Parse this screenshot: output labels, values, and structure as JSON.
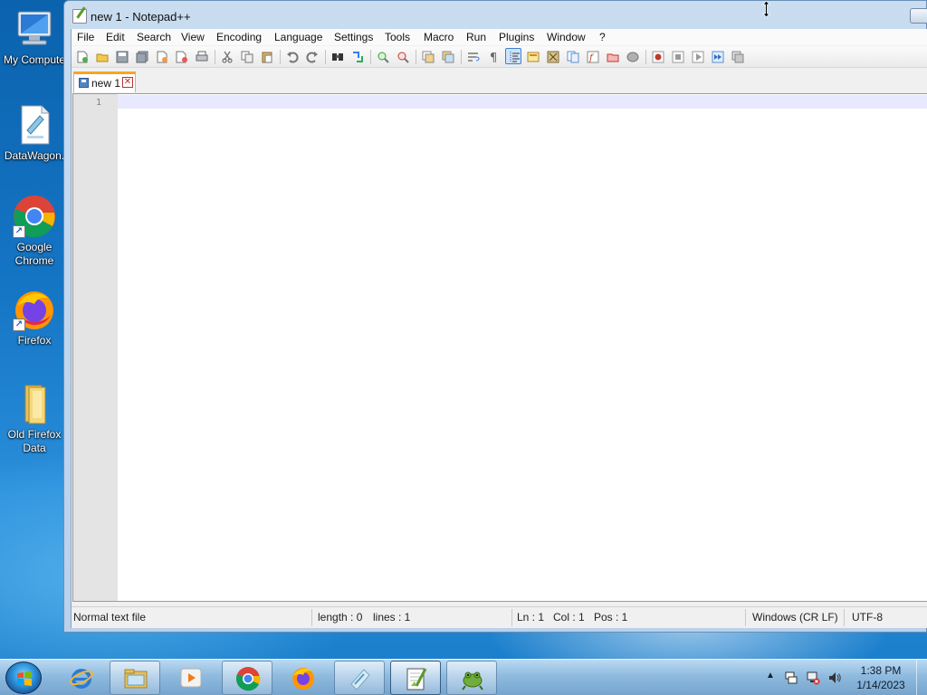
{
  "desktop": {
    "icons": [
      {
        "label": "My Compute",
        "icon": "computer-icon"
      },
      {
        "label": "DataWagon.",
        "icon": "document-icon"
      },
      {
        "label": "Google Chrome",
        "icon": "chrome-icon"
      },
      {
        "label": "Firefox",
        "icon": "firefox-icon"
      },
      {
        "label": "Old Firefox Data",
        "icon": "folder-icon"
      }
    ]
  },
  "window": {
    "title": "new 1 - Notepad++",
    "menu": [
      "File",
      "Edit",
      "Search",
      "View",
      "Encoding",
      "Language",
      "Settings",
      "Tools",
      "Macro",
      "Run",
      "Plugins",
      "Window",
      "?"
    ],
    "toolbar": [
      "new-file-icon",
      "open-file-icon",
      "save-icon",
      "save-all-icon",
      "close-icon",
      "close-all-icon",
      "print-icon",
      "cut-icon",
      "copy-icon",
      "paste-icon",
      "undo-icon",
      "redo-icon",
      "find-icon",
      "replace-icon",
      "zoom-in-icon",
      "zoom-out-icon",
      "sync-vertical-icon",
      "sync-horizontal-icon",
      "word-wrap-icon",
      "show-all-chars-icon",
      "indent-guide-icon",
      "user-defined-language-icon",
      "document-map-icon",
      "document-list-icon",
      "function-list-icon",
      "folder-as-workspace-icon",
      "monitoring-icon",
      "record-macro-icon",
      "stop-macro-icon",
      "play-macro-icon",
      "run-macro-multiple-icon",
      "save-macro-icon"
    ],
    "tab": {
      "label": "new 1"
    },
    "editor": {
      "line_number": "1"
    },
    "status": {
      "file_type": "Normal text file",
      "length": "length : 0",
      "lines": "lines : 1",
      "ln": "Ln : 1",
      "col": "Col : 1",
      "pos": "Pos : 1",
      "eol": "Windows (CR LF)",
      "encoding": "UTF-8"
    }
  },
  "taskbar": {
    "apps": [
      {
        "name": "internet-explorer-icon"
      },
      {
        "name": "file-explorer-icon"
      },
      {
        "name": "media-player-icon"
      },
      {
        "name": "chrome-icon"
      },
      {
        "name": "firefox-icon"
      },
      {
        "name": "datawagon-icon"
      },
      {
        "name": "notepadpp-icon",
        "active": true
      },
      {
        "name": "gecko-icon"
      }
    ],
    "tray": [
      "action-center-icon",
      "network-icon",
      "volume-icon"
    ],
    "clock_time": "1:38 PM",
    "clock_date": "1/14/2023"
  },
  "colors": {
    "accent": "#3c7fd1",
    "tab_highlight": "#f5a623",
    "current_line": "#e8e8ff"
  }
}
